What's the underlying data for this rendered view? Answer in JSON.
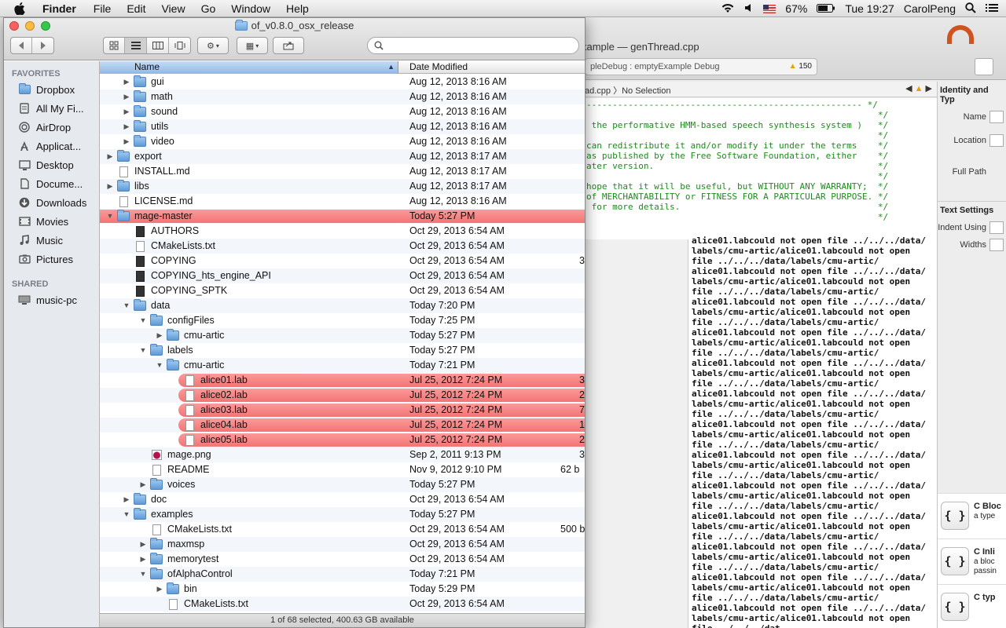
{
  "menubar": {
    "app": "Finder",
    "items": [
      "File",
      "Edit",
      "View",
      "Go",
      "Window",
      "Help"
    ],
    "battery": "67%",
    "clock": "Tue 19:27",
    "user": "CarolPeng"
  },
  "xcode": {
    "title": "xample — genThread.cpp",
    "scheme": "pleDebug : emptyExample Debug",
    "warnings": "150",
    "jumpbar": "ad.cpp 〉No Selection",
    "code": "----------------------------------------------------- */\n                                                        */\n the performative HMM-based speech synthesis system )   */\n                                                        */\ncan redistribute it and/or modify it under the terms    */\nas published by the Free Software Foundation, either    */\nater version.                                           */\n                                                        */\nhope that it will be useful, but WITHOUT ANY WARRANTY;  */\nof MERCHANTABILITY or FITNESS FOR A PARTICULAR PURPOSE. */\n for more details.                                      */\n                                                        */",
    "console_first": "alice01.labcould not open file ../../../data/",
    "console_line_a": "labels/cmu-artic/alice01.labcould not open",
    "console_line_b": "file ../../../data/labels/cmu-artic/",
    "console_line_c": "alice01.labcould not open file ../../../data/",
    "console_last": "file ../../../dat",
    "inspector": {
      "identity_head": "Identity and Typ",
      "name_label": "Name",
      "location_label": "Location",
      "full_path_label": "Full Path",
      "text_settings_head": "Text Settings",
      "indent_label": "Indent Using",
      "widths_label": "Widths",
      "snippets": [
        {
          "title": "C Bloc",
          "desc": "a type"
        },
        {
          "title": "C Inli",
          "desc": "a bloc passin"
        },
        {
          "title": "C typ",
          "desc": ""
        }
      ]
    }
  },
  "finder": {
    "title": "of_v0.8.0_osx_release",
    "search_placeholder": "",
    "sidebar": {
      "favorites_head": "FAVORITES",
      "favorites": [
        {
          "label": "Dropbox",
          "icon": "folder-icon"
        },
        {
          "label": "All My Fi...",
          "icon": "all-files-icon"
        },
        {
          "label": "AirDrop",
          "icon": "airdrop-icon"
        },
        {
          "label": "Applicat...",
          "icon": "applications-icon"
        },
        {
          "label": "Desktop",
          "icon": "desktop-icon"
        },
        {
          "label": "Docume...",
          "icon": "documents-icon"
        },
        {
          "label": "Downloads",
          "icon": "downloads-icon"
        },
        {
          "label": "Movies",
          "icon": "movies-icon"
        },
        {
          "label": "Music",
          "icon": "music-icon"
        },
        {
          "label": "Pictures",
          "icon": "pictures-icon"
        }
      ],
      "shared_head": "SHARED",
      "shared": [
        {
          "label": "music-pc",
          "icon": "computer-icon"
        }
      ]
    },
    "columns": {
      "name": "Name",
      "date": "Date Modified"
    },
    "rows": [
      {
        "name": "gui",
        "date": "Aug 12, 2013 8:16 AM",
        "size": "",
        "depth": 1,
        "kind": "folder",
        "tri": "closed"
      },
      {
        "name": "math",
        "date": "Aug 12, 2013 8:16 AM",
        "size": "",
        "depth": 1,
        "kind": "folder",
        "tri": "closed"
      },
      {
        "name": "sound",
        "date": "Aug 12, 2013 8:16 AM",
        "size": "",
        "depth": 1,
        "kind": "folder",
        "tri": "closed"
      },
      {
        "name": "utils",
        "date": "Aug 12, 2013 8:16 AM",
        "size": "",
        "depth": 1,
        "kind": "folder",
        "tri": "closed"
      },
      {
        "name": "video",
        "date": "Aug 12, 2013 8:16 AM",
        "size": "",
        "depth": 1,
        "kind": "folder",
        "tri": "closed"
      },
      {
        "name": "export",
        "date": "Aug 12, 2013 8:17 AM",
        "size": "",
        "depth": 0,
        "kind": "folder",
        "tri": "closed"
      },
      {
        "name": "INSTALL.md",
        "date": "Aug 12, 2013 8:17 AM",
        "size": "",
        "depth": 0,
        "kind": "doc",
        "tri": ""
      },
      {
        "name": "libs",
        "date": "Aug 12, 2013 8:17 AM",
        "size": "",
        "depth": 0,
        "kind": "folder",
        "tri": "closed"
      },
      {
        "name": "LICENSE.md",
        "date": "Aug 12, 2013 8:16 AM",
        "size": "",
        "depth": 0,
        "kind": "doc",
        "tri": ""
      },
      {
        "name": "mage-master",
        "date": "Today 5:27 PM",
        "size": "",
        "depth": 0,
        "kind": "folder",
        "tri": "open",
        "red": true,
        "full": true
      },
      {
        "name": "AUTHORS",
        "date": "Oct 29, 2013 6:54 AM",
        "size": "",
        "depth": 1,
        "kind": "dark",
        "tri": ""
      },
      {
        "name": "CMakeLists.txt",
        "date": "Oct 29, 2013 6:54 AM",
        "size": "",
        "depth": 1,
        "kind": "doc",
        "tri": ""
      },
      {
        "name": "COPYING",
        "date": "Oct 29, 2013 6:54 AM",
        "size": "3",
        "depth": 1,
        "kind": "dark",
        "tri": ""
      },
      {
        "name": "COPYING_hts_engine_API",
        "date": "Oct 29, 2013 6:54 AM",
        "size": "",
        "depth": 1,
        "kind": "dark",
        "tri": ""
      },
      {
        "name": "COPYING_SPTK",
        "date": "Oct 29, 2013 6:54 AM",
        "size": "",
        "depth": 1,
        "kind": "dark",
        "tri": ""
      },
      {
        "name": "data",
        "date": "Today 7:20 PM",
        "size": "",
        "depth": 1,
        "kind": "folder",
        "tri": "open"
      },
      {
        "name": "configFiles",
        "date": "Today 7:25 PM",
        "size": "",
        "depth": 2,
        "kind": "folder",
        "tri": "open"
      },
      {
        "name": "cmu-artic",
        "date": "Today 5:27 PM",
        "size": "",
        "depth": 3,
        "kind": "folder",
        "tri": "closed"
      },
      {
        "name": "labels",
        "date": "Today 5:27 PM",
        "size": "",
        "depth": 2,
        "kind": "folder",
        "tri": "open"
      },
      {
        "name": "cmu-artic",
        "date": "Today 7:21 PM",
        "size": "",
        "depth": 3,
        "kind": "folder",
        "tri": "open"
      },
      {
        "name": "alice01.lab",
        "date": "Jul 25, 2012 7:24 PM",
        "size": "3",
        "depth": 4,
        "kind": "doc",
        "tri": "",
        "red": true
      },
      {
        "name": "alice02.lab",
        "date": "Jul 25, 2012 7:24 PM",
        "size": "2",
        "depth": 4,
        "kind": "doc",
        "tri": "",
        "red": true
      },
      {
        "name": "alice03.lab",
        "date": "Jul 25, 2012 7:24 PM",
        "size": "7",
        "depth": 4,
        "kind": "doc",
        "tri": "",
        "red": true
      },
      {
        "name": "alice04.lab",
        "date": "Jul 25, 2012 7:24 PM",
        "size": "1",
        "depth": 4,
        "kind": "doc",
        "tri": "",
        "red": true
      },
      {
        "name": "alice05.lab",
        "date": "Jul 25, 2012 7:24 PM",
        "size": "2",
        "depth": 4,
        "kind": "doc",
        "tri": "",
        "red": true
      },
      {
        "name": "mage.png",
        "date": "Sep 2, 2011 9:13 PM",
        "size": "3",
        "depth": 2,
        "kind": "img",
        "tri": ""
      },
      {
        "name": "README",
        "date": "Nov 9, 2012 9:10 PM",
        "size": "62 b",
        "depth": 2,
        "kind": "doc",
        "tri": ""
      },
      {
        "name": "voices",
        "date": "Today 5:27 PM",
        "size": "",
        "depth": 2,
        "kind": "folder",
        "tri": "closed"
      },
      {
        "name": "doc",
        "date": "Oct 29, 2013 6:54 AM",
        "size": "",
        "depth": 1,
        "kind": "folder",
        "tri": "closed"
      },
      {
        "name": "examples",
        "date": "Today 5:27 PM",
        "size": "",
        "depth": 1,
        "kind": "folder",
        "tri": "open"
      },
      {
        "name": "CMakeLists.txt",
        "date": "Oct 29, 2013 6:54 AM",
        "size": "500 b",
        "depth": 2,
        "kind": "doc",
        "tri": ""
      },
      {
        "name": "maxmsp",
        "date": "Oct 29, 2013 6:54 AM",
        "size": "",
        "depth": 2,
        "kind": "folder",
        "tri": "closed"
      },
      {
        "name": "memorytest",
        "date": "Oct 29, 2013 6:54 AM",
        "size": "",
        "depth": 2,
        "kind": "folder",
        "tri": "closed"
      },
      {
        "name": "ofAlphaControl",
        "date": "Today 7:21 PM",
        "size": "",
        "depth": 2,
        "kind": "folder",
        "tri": "open"
      },
      {
        "name": "bin",
        "date": "Today 5:29 PM",
        "size": "",
        "depth": 3,
        "kind": "folder",
        "tri": "closed"
      },
      {
        "name": "CMakeLists.txt",
        "date": "Oct 29, 2013 6:54 AM",
        "size": "",
        "depth": 3,
        "kind": "doc",
        "tri": ""
      }
    ],
    "status": "1 of 68 selected, 400.63 GB available"
  }
}
